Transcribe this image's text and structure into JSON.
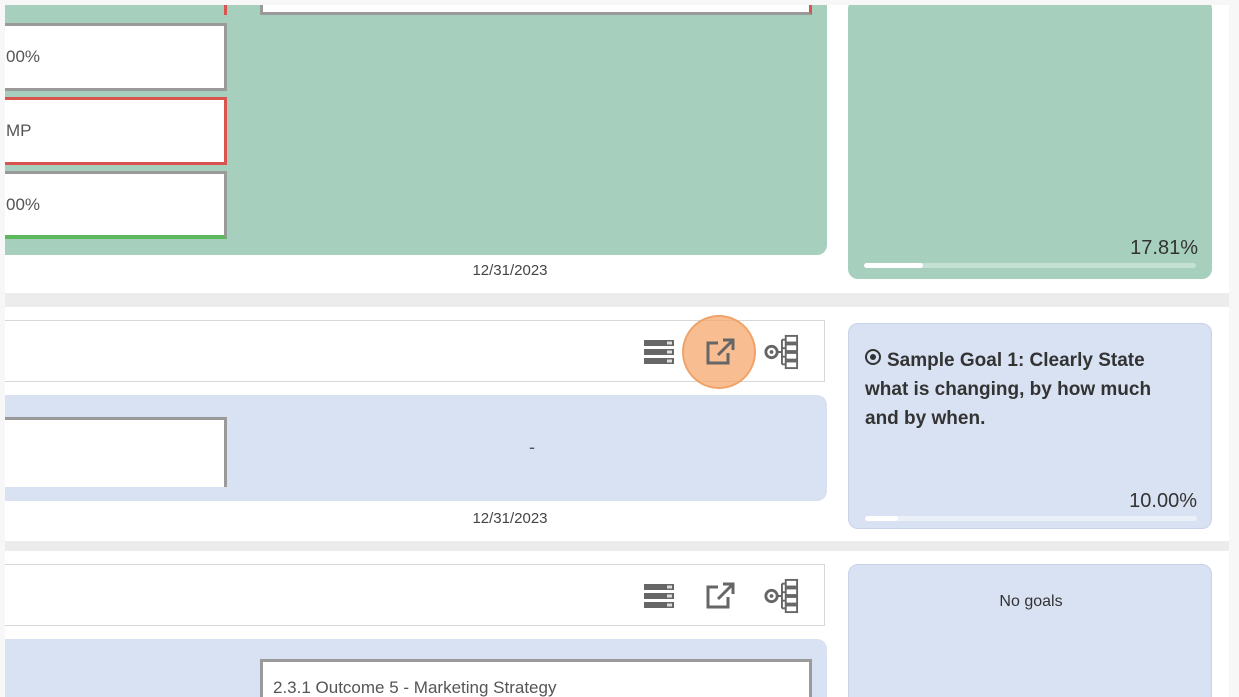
{
  "row1": {
    "metric_top": "00%",
    "status_label": "MP",
    "metric_bottom": "00%",
    "date": "12/31/2023",
    "goal_percent": "17.81%",
    "goal_progress": 0.1781
  },
  "row2": {
    "toolbar_icons": [
      "list-view-icon",
      "open-external-icon",
      "hierarchy-settings-icon"
    ],
    "center_value": "-",
    "date": "12/31/2023",
    "goal_title": "Sample Goal 1: Clearly State what is changing, by how much and by when.",
    "goal_percent": "10.00%",
    "goal_progress": 0.1
  },
  "row3": {
    "toolbar_icons": [
      "list-view-icon",
      "open-external-icon",
      "hierarchy-settings-icon"
    ],
    "outcome_label": "2.3.1  Outcome 5 - Marketing Strategy",
    "no_goals_text": "No goals"
  },
  "colors": {
    "green_panel": "#a6cfbd",
    "blue_panel": "#d9e2f3",
    "red_border": "#d9534f",
    "green_border": "#5cb85c",
    "highlight": "#f5a86e"
  }
}
